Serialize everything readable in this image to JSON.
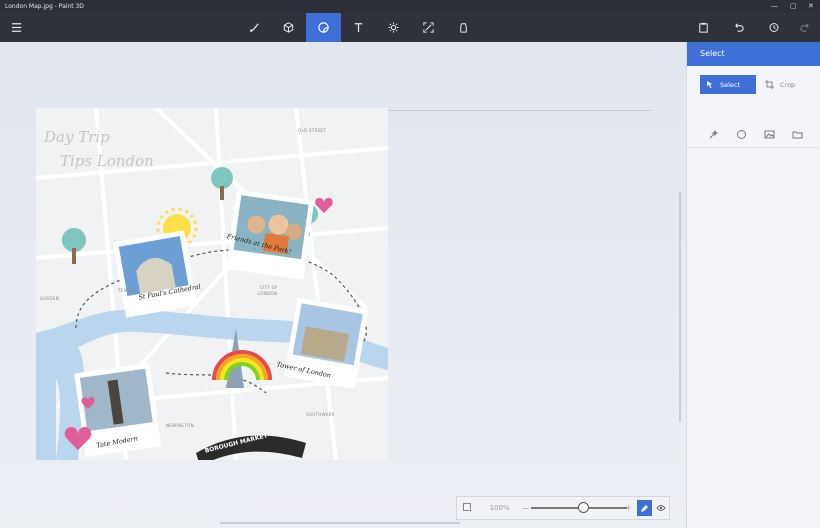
{
  "window": {
    "title": "London Map.jpg - Paint 3D",
    "controls": [
      "—",
      "▢",
      "✕"
    ]
  },
  "toolbar": {
    "menu_icon": "hamburger-icon",
    "tools": [
      {
        "name": "brushes",
        "icon": "brush-icon"
      },
      {
        "name": "3d-shapes",
        "icon": "cube-icon"
      },
      {
        "name": "stickers",
        "icon": "sticker-icon",
        "active": true
      },
      {
        "name": "text",
        "icon": "text-icon"
      },
      {
        "name": "effects",
        "icon": "sun-icon"
      },
      {
        "name": "canvas",
        "icon": "canvas-icon"
      },
      {
        "name": "3d-library",
        "icon": "library-icon"
      }
    ],
    "right": [
      "paste-icon",
      "undo-icon",
      "history-icon",
      "redo-icon"
    ]
  },
  "panel": {
    "title": "Select",
    "select_label": "Select",
    "crop_label": "Crop"
  },
  "zoom": {
    "fit_icon": "fit-icon",
    "percent": "100%",
    "minus": "—",
    "plus": "+",
    "level": 0.55
  },
  "map": {
    "handwritten_title_1": "Day Trip",
    "handwritten_title_2": "Tips London",
    "captions": [
      "St Paul's Cathedral",
      "Friends at the Park!",
      "Tower of London",
      "Tate Modern"
    ],
    "sticker_text": "BOROUGH MARKET",
    "labels": [
      "OLD STREET",
      "TEMPLE",
      "CITY OF",
      "LONDON",
      "NEWINGTON",
      "SOUTHWARK",
      "GARDEN"
    ]
  }
}
